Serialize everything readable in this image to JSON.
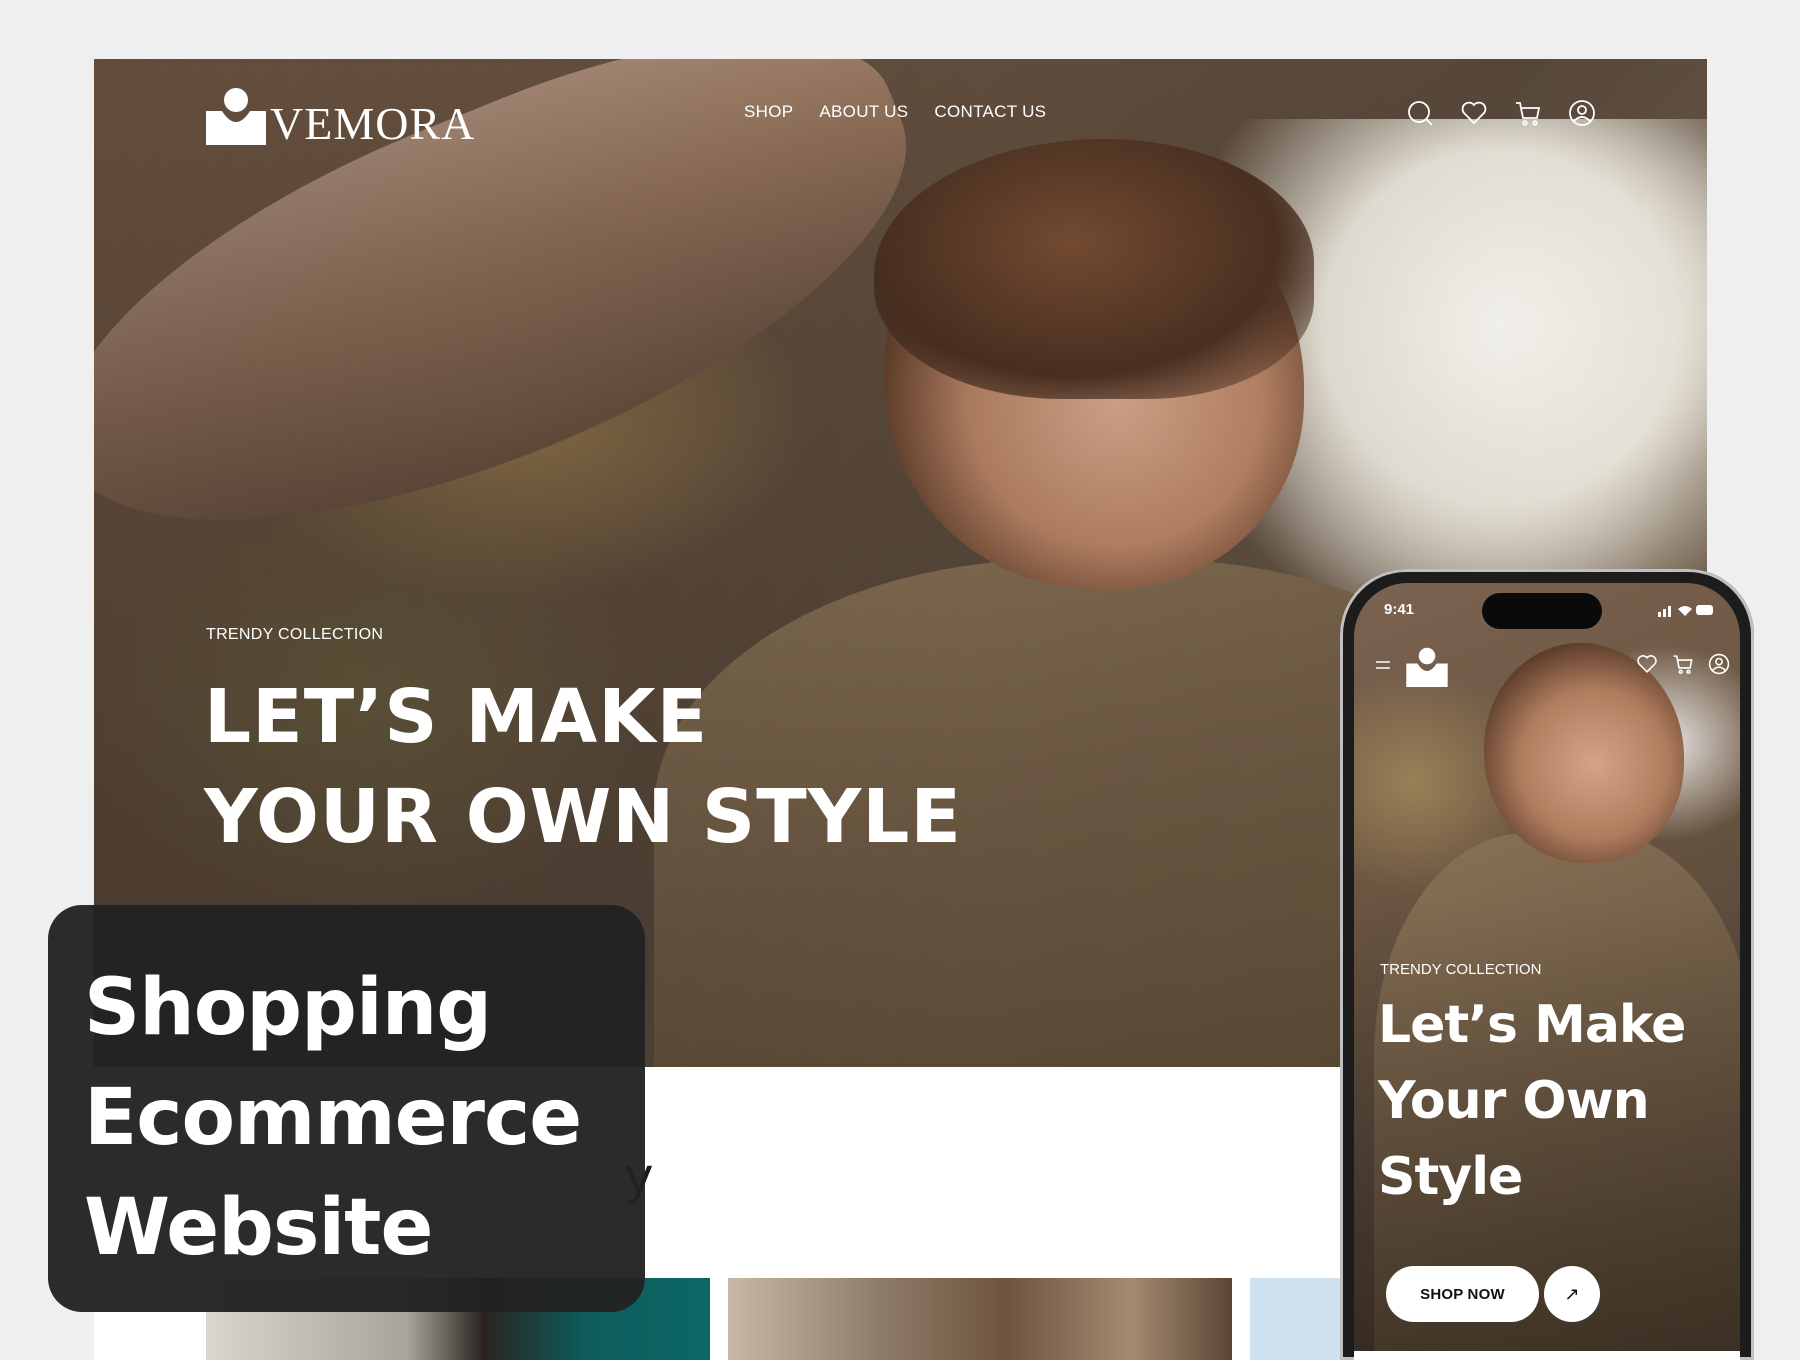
{
  "brand": {
    "name": "VEMORA"
  },
  "nav": {
    "menu": [
      {
        "label": "SHOP"
      },
      {
        "label": "ABOUT US"
      },
      {
        "label": "CONTACT US"
      }
    ],
    "icons": [
      "search-icon",
      "heart-icon",
      "cart-icon",
      "user-icon"
    ]
  },
  "hero": {
    "kicker": "TRENDY COLLECTION",
    "title_line1": "LET’S MAKE",
    "title_line2": "YOUR OWN STYLE"
  },
  "lower": {
    "heading_partial": "y"
  },
  "overlay": {
    "line1": "Shopping",
    "line2": "Ecommerce",
    "line3": "Website"
  },
  "phone": {
    "status_time": "9:41",
    "kicker": "TRENDY COLLECTION",
    "title_line1": "Let’s Make",
    "title_line2": "Your Own",
    "title_line3": "Style",
    "shop_button": "SHOP NOW",
    "arrow": "↗",
    "icons": [
      "heart-icon",
      "cart-icon",
      "user-icon"
    ]
  },
  "colors": {
    "background": "#efefef",
    "overlay": "#222222",
    "text_light": "#ffffff"
  }
}
